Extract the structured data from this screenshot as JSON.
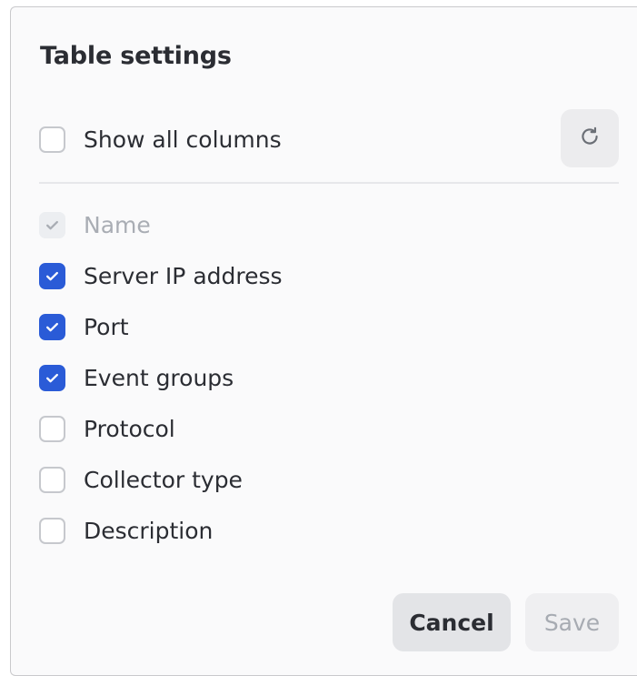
{
  "dialog": {
    "title": "Table settings",
    "show_all": {
      "label": "Show all columns",
      "checked": false
    },
    "reset_icon": "refresh-icon",
    "columns": [
      {
        "label": "Name",
        "checked": true,
        "disabled": true
      },
      {
        "label": "Server IP address",
        "checked": true,
        "disabled": false
      },
      {
        "label": "Port",
        "checked": true,
        "disabled": false
      },
      {
        "label": "Event groups",
        "checked": true,
        "disabled": false
      },
      {
        "label": "Protocol",
        "checked": false,
        "disabled": false
      },
      {
        "label": "Collector type",
        "checked": false,
        "disabled": false
      },
      {
        "label": "Description",
        "checked": false,
        "disabled": false
      }
    ],
    "buttons": {
      "cancel_label": "Cancel",
      "save_label": "Save"
    },
    "colors": {
      "accent": "#2a5bd7",
      "text": "#2b2d33",
      "disabled_text": "#a9adb4"
    }
  }
}
